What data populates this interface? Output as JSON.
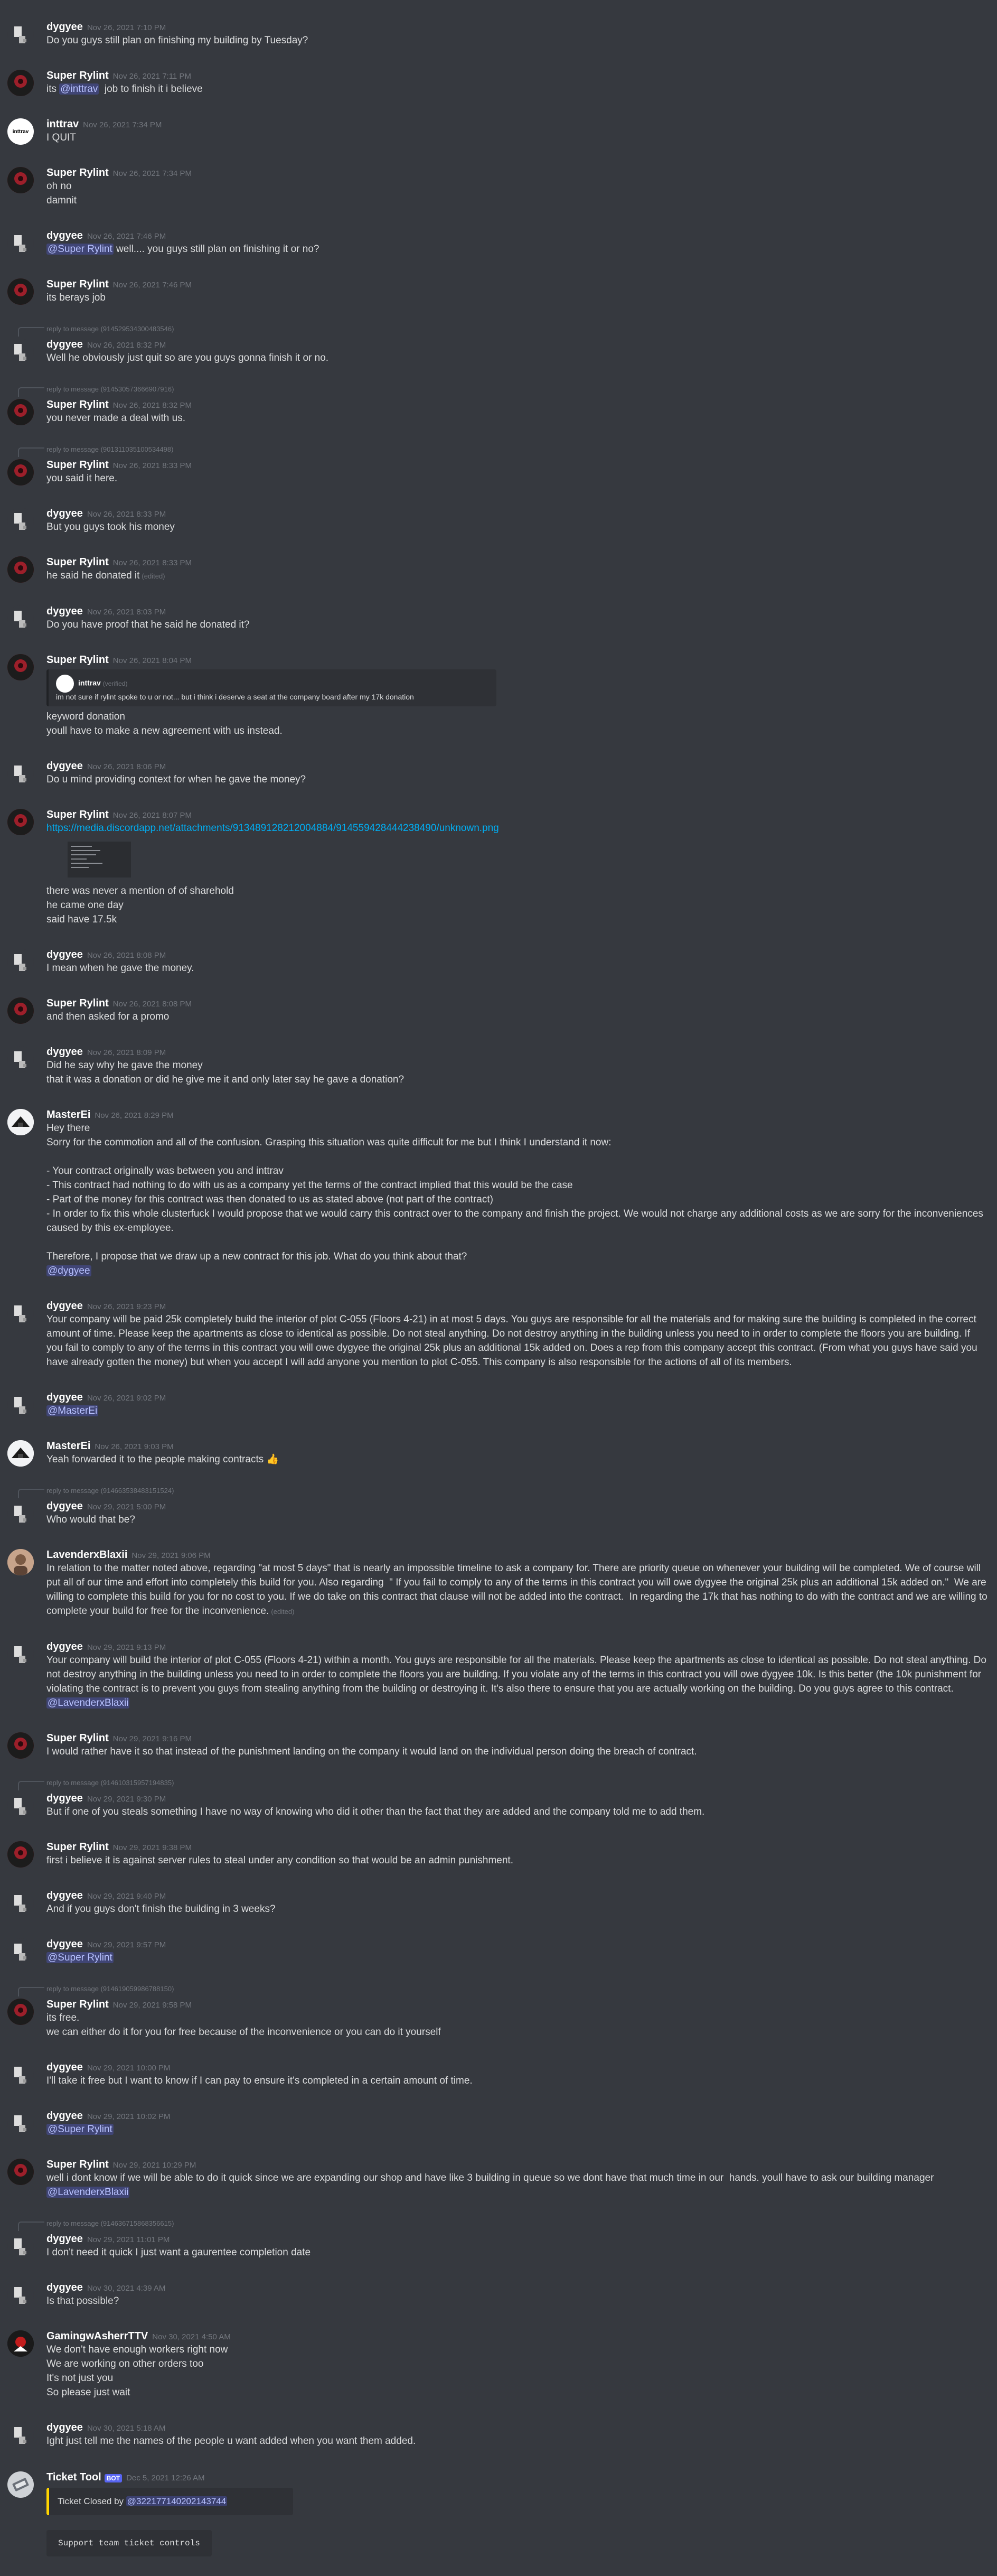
{
  "messages": [
    {
      "author": "dygyee",
      "av": "dygyee",
      "ts": "Nov 26, 2021 7:10 PM",
      "lines": [
        [
          {
            "t": "Do you guys still plan on finishing my building by Tuesday?"
          }
        ]
      ]
    },
    {
      "author": "Super Rylint",
      "av": "rylint",
      "ts": "Nov 26, 2021 7:11 PM",
      "lines": [
        [
          {
            "t": "its "
          },
          {
            "t": "@inttrav",
            "m": 1
          },
          {
            "t": "  job to finish it i believe"
          }
        ]
      ]
    },
    {
      "author": "inttrav",
      "av": "inttrav",
      "avtext": "inttrav",
      "ts": "Nov 26, 2021 7:34 PM",
      "lines": [
        [
          {
            "t": "I QUIT"
          }
        ]
      ]
    },
    {
      "author": "Super Rylint",
      "av": "rylint",
      "ts": "Nov 26, 2021 7:34 PM",
      "lines": [
        [
          {
            "t": "oh no"
          }
        ],
        [
          {
            "t": "damnit"
          }
        ]
      ]
    },
    {
      "author": "dygyee",
      "av": "dygyee",
      "ts": "Nov 26, 2021 7:46 PM",
      "lines": [
        [
          {
            "t": "@Super Rylint",
            "m": 1
          },
          {
            "t": " well.... you guys still plan on finishing it or no?"
          }
        ]
      ]
    },
    {
      "author": "Super Rylint",
      "av": "rylint",
      "ts": "Nov 26, 2021 7:46 PM",
      "lines": [
        [
          {
            "t": "its berays job"
          }
        ]
      ]
    },
    {
      "author": "dygyee",
      "av": "dygyee",
      "ts": "Nov 26, 2021 8:32 PM",
      "reply": "reply to message (914529534300483546)",
      "lines": [
        [
          {
            "t": "Well he obviously just quit so are you guys gonna finish it or no."
          }
        ]
      ]
    },
    {
      "author": "Super Rylint",
      "av": "rylint",
      "ts": "Nov 26, 2021 8:32 PM",
      "reply": "reply to message (914530573666907916)",
      "lines": [
        [
          {
            "t": "you never made a deal with us."
          }
        ]
      ]
    },
    {
      "author": "Super Rylint",
      "av": "rylint",
      "ts": "Nov 26, 2021 8:33 PM",
      "reply": "reply to message (901311035100534498)",
      "lines": [
        [
          {
            "t": "you said it here."
          }
        ]
      ]
    },
    {
      "author": "dygyee",
      "av": "dygyee",
      "ts": "Nov 26, 2021 8:33 PM",
      "lines": [
        [
          {
            "t": "But you guys took his money"
          }
        ]
      ]
    },
    {
      "author": "Super Rylint",
      "av": "rylint",
      "ts": "Nov 26, 2021 8:33 PM",
      "lines": [
        [
          {
            "t": "he said he donated it"
          },
          {
            "t": "(edited)",
            "e": 1
          }
        ]
      ]
    },
    {
      "author": "dygyee",
      "av": "dygyee",
      "ts": "Nov 26, 2021 8:03 PM",
      "lines": [
        [
          {
            "t": "Do you have proof that he said he donated it?"
          }
        ]
      ]
    },
    {
      "author": "Super Rylint",
      "av": "rylint",
      "ts": "Nov 26, 2021 8:04 PM",
      "embed": {
        "author": "inttrav",
        "tag": "(verified)",
        "text": "im not sure if rylint spoke to u or not... but i think i deserve a seat at the company board after my 17k donation"
      },
      "lines": [
        [
          {
            "t": "keyword donation"
          }
        ],
        [
          {
            "t": "youll have to make a new agreement with us instead."
          }
        ]
      ]
    },
    {
      "author": "dygyee",
      "av": "dygyee",
      "ts": "Nov 26, 2021 8:06 PM",
      "lines": [
        [
          {
            "t": "Do u mind providing context for when he gave the money?"
          }
        ]
      ]
    },
    {
      "author": "Super Rylint",
      "av": "rylint",
      "ts": "Nov 26, 2021 8:07 PM",
      "lines": [
        [
          {
            "t": "https://media.discordapp.net/attachments/913489128212004884/914559428444238490/unknown.png",
            "l": 1
          }
        ]
      ],
      "thumb": true,
      "lines2": [
        [
          {
            "t": "there was never a mention of of sharehold"
          }
        ],
        [
          {
            "t": "he came one day"
          }
        ],
        [
          {
            "t": "said have 17.5k"
          }
        ]
      ]
    },
    {
      "author": "dygyee",
      "av": "dygyee",
      "ts": "Nov 26, 2021 8:08 PM",
      "lines": [
        [
          {
            "t": "I mean when he gave the money."
          }
        ]
      ]
    },
    {
      "author": "Super Rylint",
      "av": "rylint",
      "ts": "Nov 26, 2021 8:08 PM",
      "lines": [
        [
          {
            "t": "and then asked for a promo"
          }
        ]
      ]
    },
    {
      "author": "dygyee",
      "av": "dygyee",
      "ts": "Nov 26, 2021 8:09 PM",
      "lines": [
        [
          {
            "t": "Did he say why he gave the money"
          }
        ],
        [
          {
            "t": "that it was a donation or did he give me it and only later say he gave a donation?"
          }
        ]
      ]
    },
    {
      "author": "MasterEi",
      "av": "master",
      "ts": "Nov 26, 2021 8:29 PM",
      "lines": [
        [
          {
            "t": "Hey there"
          }
        ],
        [
          {
            "t": "Sorry for the commotion and all of the confusion. Grasping this situation was quite difficult for me but I think I understand it now:"
          }
        ],
        [
          {
            "t": " "
          }
        ],
        [
          {
            "t": "- Your contract originally was between you and inttrav"
          }
        ],
        [
          {
            "t": "- This contract had nothing to do with us as a company yet the terms of the contract implied that this would be the case"
          }
        ],
        [
          {
            "t": "- Part of the money for this contract was then donated to us as stated above (not part of the contract)"
          }
        ],
        [
          {
            "t": "- In order to fix this whole clusterfuck I would propose that we would carry this contract over to the company and finish the project. We would not charge any additional costs as we are sorry for the inconveniences caused by this ex-employee."
          }
        ],
        [
          {
            "t": " "
          }
        ],
        [
          {
            "t": "Therefore, I propose that we draw up a new contract for this job. What do you think about that?"
          }
        ],
        [
          {
            "t": "@dygyee",
            "m": 1
          }
        ]
      ]
    },
    {
      "author": "dygyee",
      "av": "dygyee",
      "ts": "Nov 26, 2021 9:23 PM",
      "lines": [
        [
          {
            "t": "Your company will be paid 25k completely build the interior of plot C-055 (Floors 4-21) in at most 5 days. You guys are responsible for all the materials and for making sure the building is completed in the correct amount of time. Please keep the apartments as close to identical as possible. Do not steal anything. Do not destroy anything in the building unless you need to in order to complete the floors you are building. If you fail to comply to any of the terms in this contract you will owe dygyee the original 25k plus an additional 15k added on. Does a rep from this company accept this contract. (From what you guys have said you have already gotten the money) but when you accept I will add anyone you mention to plot C-055. This company is also responsible for the actions of all of its members."
          }
        ]
      ]
    },
    {
      "author": "dygyee",
      "av": "dygyee",
      "ts": "Nov 26, 2021 9:02 PM",
      "lines": [
        [
          {
            "t": "@MasterEi",
            "m": 1
          }
        ]
      ]
    },
    {
      "author": "MasterEi",
      "av": "master",
      "ts": "Nov 26, 2021 9:03 PM",
      "lines": [
        [
          {
            "t": "Yeah forwarded it to the people making contracts "
          },
          {
            "t": "👍",
            "ok": 1
          }
        ]
      ]
    },
    {
      "author": "dygyee",
      "av": "dygyee",
      "ts": "Nov 29, 2021 5:00 PM",
      "reply": "reply to message (914663538483151524)",
      "lines": [
        [
          {
            "t": "Who would that be?"
          }
        ]
      ]
    },
    {
      "author": "LavenderxBlaxii",
      "av": "lav",
      "ts": "Nov 29, 2021 9:06 PM",
      "lines": [
        [
          {
            "t": "In relation to the matter noted above, regarding \"at most 5 days\" that is nearly an impossible timeline to ask a company for. There are priority queue on whenever your building will be completed. We of course will put all of our time and effort into completely this build for you. Also regarding  \" If you fail to comply to any of the terms in this contract you will owe dygyee the original 25k plus an additional 15k added on.\"  We are willing to complete this build for you for no cost to you. If we do take on this contract that clause will not be added into the contract.  In regarding the 17k that has nothing to do with the contract and we are willing to complete your build for free for the inconvenience."
          },
          {
            "t": "(edited)",
            "e": 1
          }
        ]
      ]
    },
    {
      "author": "dygyee",
      "av": "dygyee",
      "ts": "Nov 29, 2021 9:13 PM",
      "lines": [
        [
          {
            "t": "Your company will build the interior of plot C-055 (Floors 4-21) within a month. You guys are responsible for all the materials. Please keep the apartments as close to identical as possible. Do not steal anything. Do not destroy anything in the building unless you need to in order to complete the floors you are building. If you violate any of the terms in this contract you will owe dygyee 10k. Is this better (the 10k punishment for violating the contract is to prevent you guys from stealing anything from the building or destroying it. It's also there to ensure that you are actually working on the building. Do you guys agree to this contract."
          }
        ],
        [
          {
            "t": "@LavenderxBlaxii",
            "m": 1
          }
        ]
      ]
    },
    {
      "author": "Super Rylint",
      "av": "rylint",
      "ts": "Nov 29, 2021 9:16 PM",
      "lines": [
        [
          {
            "t": "I would rather have it so that instead of the punishment landing on the company it would land on the individual person doing the breach of contract."
          }
        ]
      ]
    },
    {
      "author": "dygyee",
      "av": "dygyee",
      "ts": "Nov 29, 2021 9:30 PM",
      "reply": "reply to message (914610315957194835)",
      "lines": [
        [
          {
            "t": "But if one of you steals something I have no way of knowing who did it other than the fact that they are added and the company told me to add them."
          }
        ]
      ]
    },
    {
      "author": "Super Rylint",
      "av": "rylint",
      "ts": "Nov 29, 2021 9:38 PM",
      "lines": [
        [
          {
            "t": "first i believe it is against server rules to steal under any condition so that would be an admin punishment."
          }
        ]
      ]
    },
    {
      "author": "dygyee",
      "av": "dygyee",
      "ts": "Nov 29, 2021 9:40 PM",
      "lines": [
        [
          {
            "t": "And if you guys don't finish the building in 3 weeks?"
          }
        ]
      ]
    },
    {
      "author": "dygyee",
      "av": "dygyee",
      "ts": "Nov 29, 2021 9:57 PM",
      "lines": [
        [
          {
            "t": "@Super Rylint",
            "m": 1
          }
        ]
      ]
    },
    {
      "author": "Super Rylint",
      "av": "rylint",
      "ts": "Nov 29, 2021 9:58 PM",
      "reply": "reply to message (914619059986788150)",
      "lines": [
        [
          {
            "t": "its free."
          }
        ],
        [
          {
            "t": "we can either do it for you for free because of the inconvenience or you can do it yourself"
          }
        ]
      ]
    },
    {
      "author": "dygyee",
      "av": "dygyee",
      "ts": "Nov 29, 2021 10:00 PM",
      "lines": [
        [
          {
            "t": "I'll take it free but I want to know if I can pay to ensure it's completed in a certain amount of time."
          }
        ]
      ]
    },
    {
      "author": "dygyee",
      "av": "dygyee",
      "ts": "Nov 29, 2021 10:02 PM",
      "lines": [
        [
          {
            "t": "@Super Rylint",
            "m": 1
          }
        ]
      ]
    },
    {
      "author": "Super Rylint",
      "av": "rylint",
      "ts": "Nov 29, 2021 10:29 PM",
      "lines": [
        [
          {
            "t": "well i dont know if we will be able to do it quick since we are expanding our shop and have like 3 building in queue so we dont have that much time in our  hands. youll have to ask our building manager "
          },
          {
            "t": "@LavenderxBlaxii",
            "m": 1
          }
        ]
      ]
    },
    {
      "author": "dygyee",
      "av": "dygyee",
      "ts": "Nov 29, 2021 11:01 PM",
      "reply": "reply to message (914636715868356615)",
      "lines": [
        [
          {
            "t": "I don't need it quick I just want a gaurentee completion date"
          }
        ]
      ]
    },
    {
      "author": "dygyee",
      "av": "dygyee",
      "ts": "Nov 30, 2021 4:39 AM",
      "lines": [
        [
          {
            "t": "Is that possible?"
          }
        ]
      ]
    },
    {
      "author": "GamingwAsherrTTV",
      "av": "gaming",
      "ts": "Nov 30, 2021 4:50 AM",
      "lines": [
        [
          {
            "t": "We don't have enough workers right now"
          }
        ],
        [
          {
            "t": "We are working on other orders too"
          }
        ],
        [
          {
            "t": "It's not just you"
          }
        ],
        [
          {
            "t": "So please just wait"
          }
        ]
      ]
    },
    {
      "author": "dygyee",
      "av": "dygyee",
      "ts": "Nov 30, 2021 5:18 AM",
      "lines": [
        [
          {
            "t": "Ight just tell me the names of the people u want added when you want them added."
          }
        ]
      ]
    }
  ],
  "bot_message": {
    "author": "Ticket Tool",
    "badge": "BOT",
    "ts": "Dec 5, 2021 12:26 AM",
    "embed_prefix": "Ticket Closed by ",
    "embed_mention": "@322177140202143744",
    "button": "Support team ticket controls"
  },
  "colors": {
    "background": "#36393f",
    "mention": "#b8c2ff",
    "link": "#00aff4",
    "embed_accent": "#ffd400",
    "timestamp": "#72767d"
  }
}
